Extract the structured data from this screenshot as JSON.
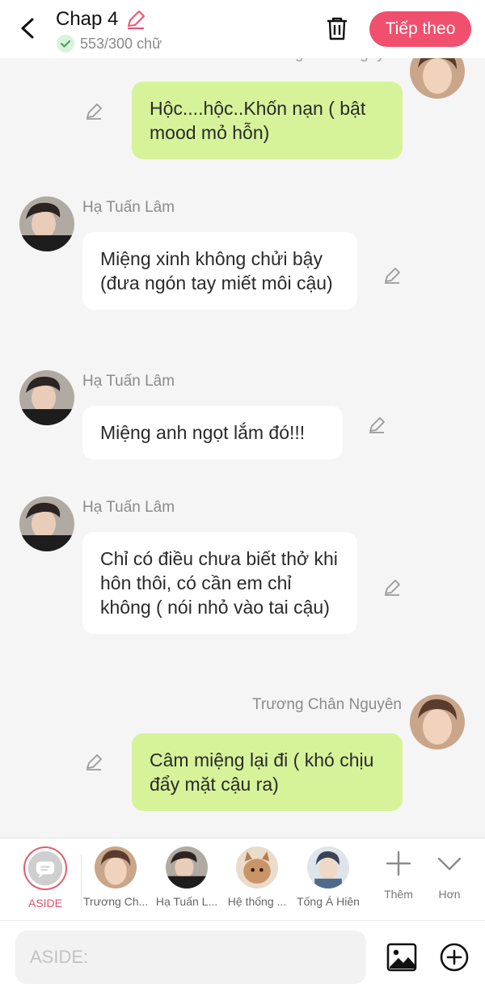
{
  "header": {
    "title": "Chap 4",
    "word_count": "553/300 chữ",
    "next_label": "Tiếp theo",
    "accent": "#f0506e",
    "icons": [
      "back-arrow-icon",
      "pencil-icon",
      "check-circle-icon",
      "trash-icon"
    ]
  },
  "messages": [
    {
      "side": "right",
      "sender": "Trương Chân Nguyên",
      "text": "Hộc....hộc..Khốn nạn ( bật mood mỏ hỗn)"
    },
    {
      "side": "left",
      "sender": "Hạ Tuấn Lâm",
      "text": "Miệng xinh không chửi bậy (đưa ngón tay miết môi cậu)"
    },
    {
      "side": "left",
      "sender": "Hạ Tuấn Lâm",
      "text": "Miệng anh ngọt lắm đó!!!"
    },
    {
      "side": "left",
      "sender": "Hạ Tuấn Lâm",
      "text": "Chỉ có điều chưa biết thở khi hôn thôi, có cần em chỉ không ( nói nhỏ vào tai cậu)"
    },
    {
      "side": "right",
      "sender": "Trương Chân Nguyên",
      "text": "Câm miệng lại đi ( khó chịu đẩy mặt cậu ra)"
    }
  ],
  "characters": {
    "aside": "ASIDE",
    "list": [
      "Trương Ch...",
      "Hạ Tuấn L...",
      "Hệ thống ...",
      "Tống Á Hiên"
    ],
    "more": "Thêm",
    "collapse": "Hơn"
  },
  "input": {
    "placeholder": "ASIDE:"
  },
  "colors": {
    "bubble_right": "#d6f39a",
    "bubble_left": "#ffffff",
    "background": "#f5f5f5"
  }
}
